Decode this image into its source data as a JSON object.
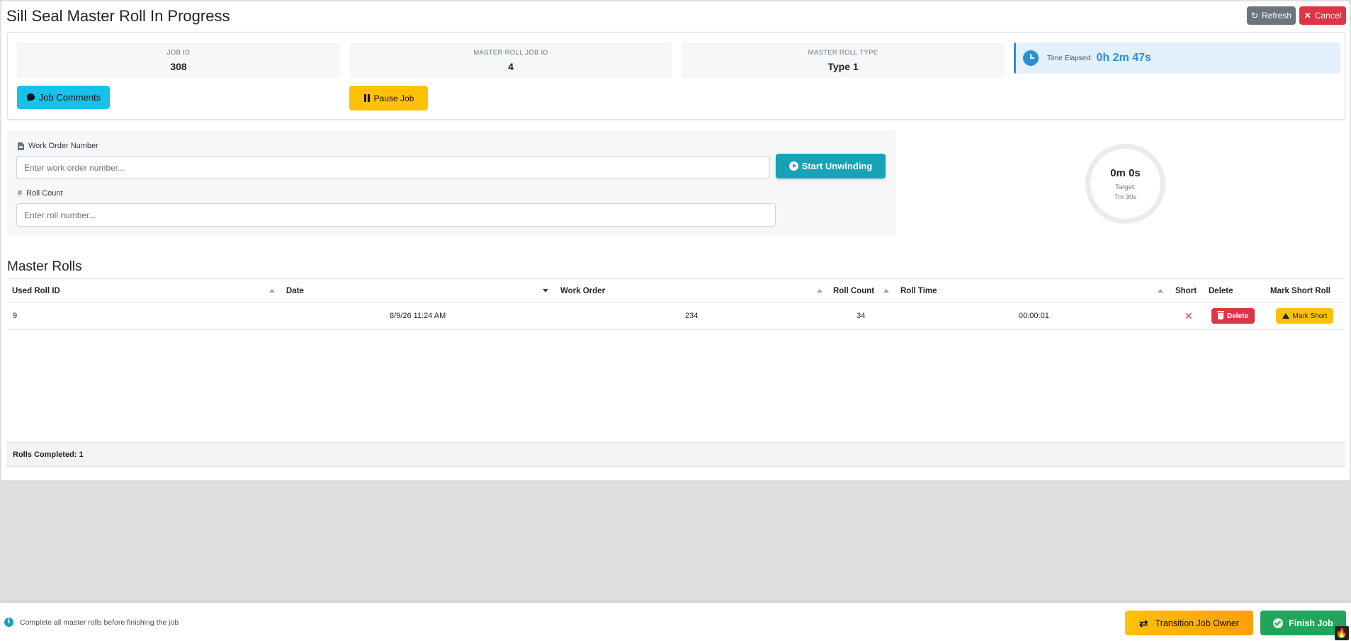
{
  "header": {
    "title": "Sill Seal Master Roll In Progress",
    "refresh_label": "Refresh",
    "cancel_label": "Cancel"
  },
  "job_info": {
    "job_id_label": "JOB ID",
    "job_id": "308",
    "master_roll_job_id_label": "MASTER ROLL JOB ID",
    "master_roll_job_id": "4",
    "master_roll_type_label": "MASTER ROLL TYPE",
    "master_roll_type": "Type 1",
    "time_elapsed_label": "Time Elapsed:",
    "time_elapsed": "0h 2m 47s",
    "comments_label": "Job Comments",
    "pause_label": "Pause Job"
  },
  "form": {
    "work_order_label": "Work Order Number",
    "work_order_placeholder": "Enter work order number...",
    "roll_count_label": "Roll Count",
    "roll_count_placeholder": "Enter roll number...",
    "start_label": "Start Unwinding"
  },
  "timer": {
    "value": "0m 0s",
    "target": "Target: 7m 30s"
  },
  "master_rolls": {
    "title": "Master Rolls",
    "columns": {
      "used_roll_id": "Used Roll ID",
      "date": "Date",
      "work_order": "Work Order",
      "roll_count": "Roll Count",
      "roll_time": "Roll Time",
      "short": "Short",
      "delete": "Delete",
      "mark_short": "Mark Short Roll"
    },
    "rows": [
      {
        "used_roll_id": "9",
        "date": "8/9/26 11:24 AM",
        "work_order": "234",
        "roll_count": "34",
        "roll_time": "00:00:01",
        "delete_label": "Delete",
        "mark_short_label": "Mark Short"
      }
    ],
    "footer": "Rolls Completed: 1"
  },
  "bottom_bar": {
    "message": "Complete all master rolls before finishing the job",
    "transition_label": "Transition Job Owner",
    "finish_label": "Finish Job"
  },
  "colors": {
    "primary_blue": "#2b8fd9",
    "teal": "#17a2b8",
    "danger": "#dc3545",
    "warning": "#ffc107",
    "success": "#22a55a"
  }
}
